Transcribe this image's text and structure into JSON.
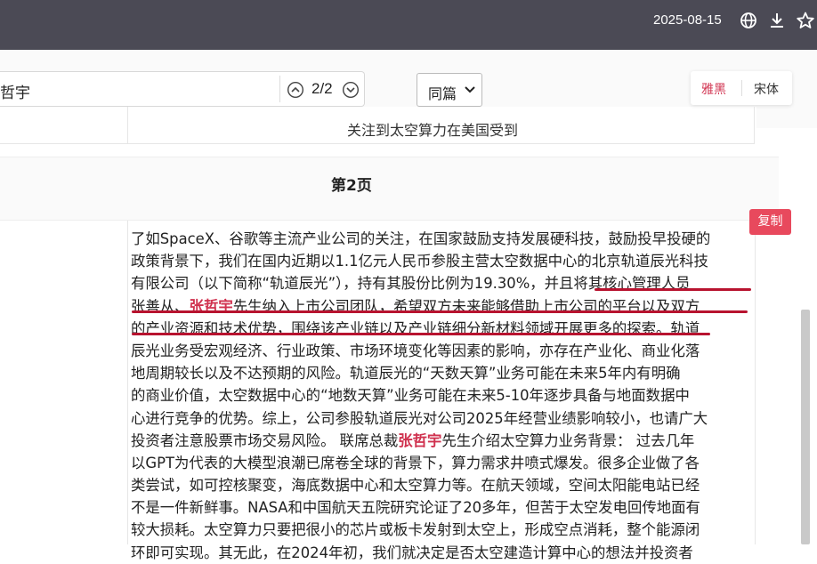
{
  "topbar": {
    "date": "2025-08-15",
    "icons": [
      "globe-icon",
      "download-icon",
      "star-icon"
    ]
  },
  "search": {
    "value": "哲宇",
    "match_count": "2/2"
  },
  "scope_select": {
    "selected": "同篇"
  },
  "font_toggle": {
    "yahei": "雅黑",
    "songti": "宋体",
    "active": "雅黑",
    "active_color": "#d0324f"
  },
  "previous_row": {
    "text": "关注到太空算力在美国受到"
  },
  "page_header": {
    "title": "第2页"
  },
  "copy_button": {
    "label": "复制"
  },
  "colors": {
    "topbar": "#4b4a55",
    "highlight": "#d0324f",
    "underline": "#b8132f"
  },
  "content_lines": [
    [
      {
        "t": "了如SpaceX、谷歌等主流产业公司的关注，在国家鼓励支持发展硬科技，鼓励投早投硬的"
      }
    ],
    [
      {
        "t": "政策背景下，我们在国内近期以1.1亿元人民币参股主营太空数据中心的北京轨道辰光科技"
      }
    ],
    [
      {
        "t": "有限公司（以下简称“轨道辰光”），持有其股份比例为19.30%，并且将其核心管理人员"
      }
    ],
    [
      {
        "t": "张善从、"
      },
      {
        "t": "张哲宇",
        "hl": true
      },
      {
        "t": "先生纳入上市公司团队，希望双方未来能够借助上市公司的平台以及双方"
      }
    ],
    [
      {
        "t": "的产业资源和技术优势，围绕该产业链以及产业链细分新材料领域开展更多的探索。轨道"
      }
    ],
    [
      {
        "t": "辰光业务受宏观经济、行业政策、市场环境变化等因素的影响，亦存在产业化、商业化落"
      }
    ],
    [
      {
        "t": " 地周期较长以及不达预期的风险。轨道辰光的“天数天算”业务可能在未来5年内有明确"
      }
    ],
    [
      {
        "t": " 的商业价值，太空数据中心的“地数天算”业务可能在未来5-10年逐步具备与地面数据中"
      }
    ],
    [
      {
        "t": "心进行竞争的优势。综上，公司参股轨道辰光对公司2025年经营业绩影响较小，也请广大"
      }
    ],
    [
      {
        "t": " 投资者注意股票市场交易风险。 联席总裁"
      },
      {
        "t": "张哲宇",
        "hl": true
      },
      {
        "t": "先生介绍太空算力业务背景： 过去几年"
      }
    ],
    [
      {
        "t": " 以GPT为代表的大模型浪潮已席卷全球的背景下，算力需求井喷式爆发。很多企业做了各"
      }
    ],
    [
      {
        "t": " 类尝试，如可控核聚变，海底数据中心和太空算力等。在航天领域，空间太阳能电站已经"
      }
    ],
    [
      {
        "t": " 不是一件新鲜事。NASA和中国航天五院研究论证了20多年，但苦于太空发电回传地面有"
      }
    ],
    [
      {
        "t": " 较大损耗。太空算力只要把很小的芯片或板卡发射到太空上，形成空点消耗，整个能源闭"
      }
    ],
    [
      {
        "t": " 环即可实现。其无此，在2024年初，我们就决定是否太空建造计算中心的想法并投资者"
      }
    ]
  ]
}
